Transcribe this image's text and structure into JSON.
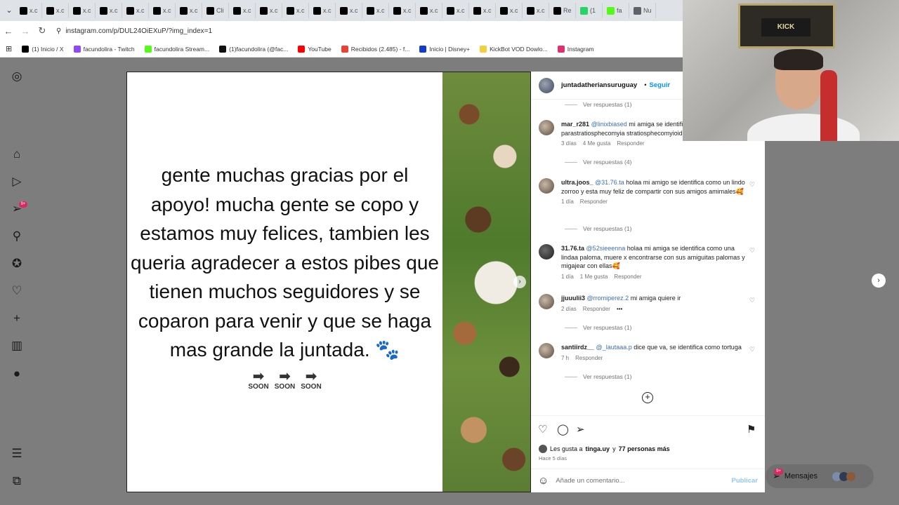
{
  "browser": {
    "tabs": [
      {
        "label": "x.c",
        "icon": "x-icon"
      },
      {
        "label": "x.c",
        "icon": "x-icon"
      },
      {
        "label": "x.c",
        "icon": "x-icon"
      },
      {
        "label": "x.c",
        "icon": "x-icon"
      },
      {
        "label": "x.c",
        "icon": "x-icon"
      },
      {
        "label": "x.c",
        "icon": "x-icon"
      },
      {
        "label": "x.c",
        "icon": "x-icon"
      },
      {
        "label": "Cli",
        "icon": "x-icon"
      },
      {
        "label": "x.c",
        "icon": "x-icon"
      },
      {
        "label": "x.c",
        "icon": "x-icon"
      },
      {
        "label": "x.c",
        "icon": "x-icon"
      },
      {
        "label": "x.c",
        "icon": "x-icon"
      },
      {
        "label": "x.c",
        "icon": "x-icon"
      },
      {
        "label": "x.c",
        "icon": "x-icon"
      },
      {
        "label": "x.c",
        "icon": "x-icon"
      },
      {
        "label": "x.c",
        "icon": "x-icon"
      },
      {
        "label": "x.c",
        "icon": "x-icon"
      },
      {
        "label": "x.c",
        "icon": "x-icon"
      },
      {
        "label": "x.c",
        "icon": "x-icon"
      },
      {
        "label": "x.c",
        "icon": "x-icon"
      },
      {
        "label": "Re",
        "icon": "x-icon"
      },
      {
        "label": "(1",
        "icon": "whatsapp-icon"
      },
      {
        "label": "fa",
        "icon": "kick-icon"
      },
      {
        "label": "Nu",
        "icon": "chrome-icon"
      }
    ],
    "url": "instagram.com/p/DUL24OiEXuP/?img_index=1",
    "bookmarks": [
      {
        "label": "(1) Inicio / X",
        "color": "#000000"
      },
      {
        "label": "facundolira - Twitch",
        "color": "#9146ff"
      },
      {
        "label": "facundolira Stream...",
        "color": "#53fc18"
      },
      {
        "label": "(1)facundolira (@fac...",
        "color": "#111111"
      },
      {
        "label": "YouTube",
        "color": "#ff0000"
      },
      {
        "label": "Recibidos (2.485) - f...",
        "color": "#ea4335"
      },
      {
        "label": "Inicio | Disney+",
        "color": "#113ccf"
      },
      {
        "label": "KickBot VOD Dowlo...",
        "color": "#f4d03f"
      },
      {
        "label": "Instagram",
        "color": "#e1306c"
      }
    ]
  },
  "sidebar": {
    "notifications_badge": "9+"
  },
  "post": {
    "image_text": "gente muchas gracias por el apoyo! mucha gente se copo y estamos muy felices, tambien les queria agradecer a estos pibes que tienen muchos seguidores y se coparon para venir y que se haga mas grande la juntada. 🐾",
    "soon_label": "SOON",
    "author": "juntadatheriansuruguay",
    "follow_label": "Seguir"
  },
  "comments": {
    "replies_top": "Ver respuestas (1)",
    "items": [
      {
        "user": "mar_r281",
        "mention": "@linixbiased",
        "text": " mi amiga se identifica como parastratiosphecomyia stratiosphecomyioides",
        "time": "3 días",
        "likes": "4 Me gusta",
        "reply": "Responder",
        "replies": "Ver respuestas (4)"
      },
      {
        "user": "ultra.joos_",
        "mention": "@31.76.ta",
        "text": " holaa mi amigo se identifica como un lindo zorroo y esta muy feliz de compartir con sus amigos amimales🥰",
        "time": "1 día",
        "likes": "",
        "reply": "Responder",
        "replies": "Ver respuestas (1)"
      },
      {
        "user": "31.76.ta",
        "mention": "@52sieeenna",
        "text": " holaa mi amiga se identifica como una lindaa paloma, muere x encontrarse con sus amiguitas palomas y migajear con ellas🥰",
        "time": "1 día",
        "likes": "1 Me gusta",
        "reply": "Responder",
        "replies": ""
      },
      {
        "user": "jjuuulii3",
        "mention": "@rromiperez.2",
        "text": " mi amiga quiere ir",
        "time": "2 días",
        "likes": "",
        "reply": "Responder",
        "replies": "Ver respuestas (1)"
      },
      {
        "user": "santiirdz__",
        "mention": "@_lautaaa.p",
        "text": " dice que va, se identifica como tortuga",
        "time": "7 h",
        "likes": "",
        "reply": "Responder",
        "replies": "Ver respuestas (1)"
      }
    ],
    "more_dots": "•••"
  },
  "footer": {
    "likes_prefix": "Les gusta a ",
    "likes_user": "tinga.uy",
    "likes_mid": " y ",
    "likes_count": "77 personas más",
    "ago": "Hace 5 días",
    "add_comment_placeholder": "Añade un comentario...",
    "publish_label": "Publicar"
  },
  "messages": {
    "label": "Mensajes",
    "badge": "9+"
  },
  "webcam": {
    "frame_text": "KICK"
  }
}
